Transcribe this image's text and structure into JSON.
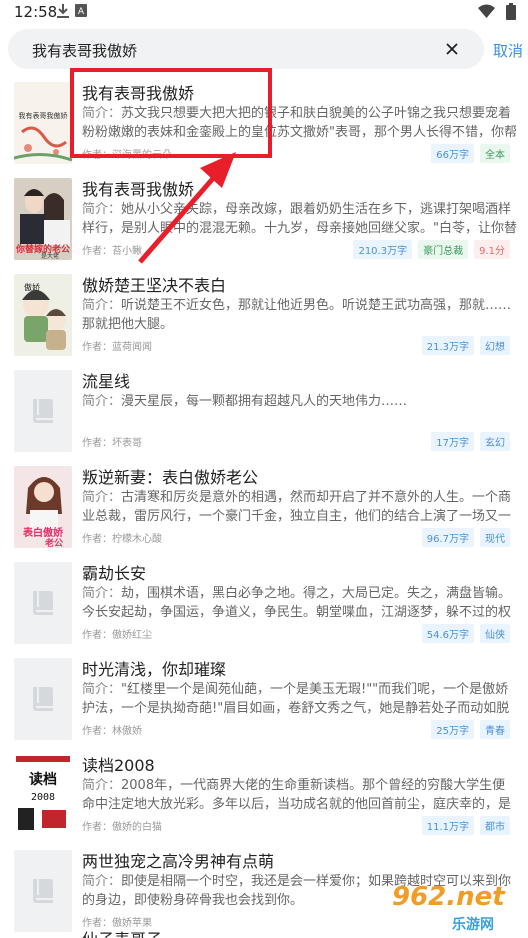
{
  "status": {
    "time": "12:58"
  },
  "search": {
    "query": "我有表哥我傲娇",
    "cancel_label": "取消"
  },
  "results": [
    {
      "title": "我有表哥我傲娇",
      "desc_label": "简介：",
      "desc": "苏文我只想要大把大把的银子和肤白貌美的公子叶锦之我只想要宠着粉粉嫩嫩的表妹和金銮殿上的皇位苏文撒娇\"表哥，那个男人长得不错，你帮我把他哄进后院",
      "author": "作者：深海黑的云朵",
      "tags": [
        "66万字",
        "全本"
      ],
      "cover": "illustration"
    },
    {
      "title": "我有表哥我傲娇",
      "desc_label": "简介：",
      "desc": "她从小父亲失踪，母亲改嫁，跟着奶奶生活在乡下，逃课打架喝酒样样行，是别人眼中的混混无赖。十九岁，母亲接她回继父家。\"白苓，让你替你妹妹嫁给傅家",
      "author": "作者：苔小鳅",
      "tags": [
        "210.3万字",
        "豪门总裁",
        "9.1分"
      ],
      "cover": "couple"
    },
    {
      "title": "傲娇楚王坚决不表白",
      "desc_label": "简介：",
      "desc": "听说楚王不近女色，那就让他近男色。听说楚王武功高强，那就……那就把他大腿。",
      "author": "作者：蓝荷闻闻",
      "tags": [
        "21.3万字",
        "幻想"
      ],
      "cover": "chibi"
    },
    {
      "title": "流星线",
      "desc_label": "简介：",
      "desc": "漫天星辰，每一颗都拥有超越凡人的天地伟力……",
      "author": "作者：坏表哥",
      "tags": [
        "17万字",
        "玄幻"
      ],
      "cover": "placeholder"
    },
    {
      "title": "叛逆新妻：表白傲娇老公",
      "desc_label": "简介：",
      "desc": "古清寒和厉炎是意外的相遇，然而却开启了并不意外的人生。一个商业总裁，雷厉风行，一个豪门千金，独立自主，他们的结合上演了一场又一场惊心动魄的爱",
      "author": "作者：柠檬木心酸",
      "tags": [
        "96.7万字",
        "现代"
      ],
      "cover": "girl"
    },
    {
      "title": "霸劫长安",
      "desc_label": "简介：",
      "desc": "劫，围棋术语，黑白必争之地。得之，大局已定。失之，满盘皆输。今长安起劫，争国运，争道义，争民生。朝堂喋血，江湖逐梦，躲不过的权谋手段，用不尽",
      "author": "作者：傲娇红尘",
      "tags": [
        "54.6万字",
        "仙侠"
      ],
      "cover": "placeholder"
    },
    {
      "title": "时光清浅，你却璀璨",
      "desc_label": "简介：",
      "desc": "\"红楼里一个是阆苑仙葩，一个是美玉无瑕!\"\"而我们呢，一个是傲娇护法，一个是执拗奇葩!\"眉目如画，卷舒文秀之气，她是静若处子而动如脱兔，距\"才女\"林",
      "author": "作者：林傲娇",
      "tags": [
        "25万字",
        "青春"
      ],
      "cover": "placeholder"
    },
    {
      "title": "读档2008",
      "desc_label": "简介：",
      "desc": "2008年，一代商界大佬的生命重新读档。那个曾经的穷酸大学生便命中注定地大放光彩。多年以后，当功成名就的他回首前尘，庭庆幸的，是他不曾辜负那春夏",
      "author": "作者：傲娇的白猫",
      "tags": [
        "11.1万字",
        "都市"
      ],
      "cover": "readsave"
    },
    {
      "title": "两世独宠之高冷男神有点萌",
      "desc_label": "简介：",
      "desc": "即使是相隔一个时空，我还是会一样爱你；如果跨越时空可以来到你的身边，即使粉身碎骨我也会找到你。",
      "author": "作者：傲娇苹果",
      "tags": [],
      "cover": "placeholder"
    }
  ],
  "bottom_peek": "仙子表哥子",
  "watermark": {
    "brand": "962.net",
    "sub": "乐游网"
  }
}
